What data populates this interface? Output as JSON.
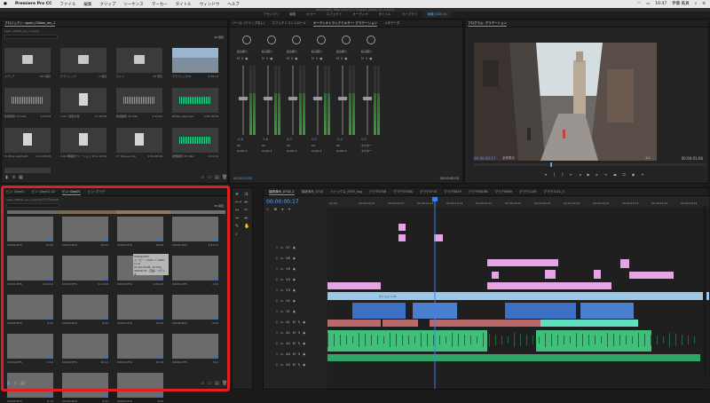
{
  "menubar": {
    "app_name": "Premiere Pro CC",
    "items": [
      "ファイル",
      "編集",
      "クリップ",
      "シーケンス",
      "マーカー",
      "タイトル",
      "ウィンドウ",
      "ヘルプ"
    ],
    "time": "16:47",
    "user": "伊藤 皓真"
  },
  "titlebar": {
    "text": "/Volumes/ito_Hikaru/Pro/ファイル/spain_03kbw_rev_1.prproj"
  },
  "workspaces": {
    "items": [
      "アセンブリ",
      "編集",
      "カラー",
      "エフェクト",
      "オーディオ",
      "タイトル",
      "ライブラリ",
      "編集 (CS5.5)"
    ],
    "active_index": 7
  },
  "project_panel": {
    "tab": "プロジェクト: spain_03kbw_rev_1",
    "project_file": "spain_03kbw_rev_1.prproj",
    "item_count": "46 項目",
    "items": [
      {
        "name": "メディア",
        "info": "101 項目",
        "kind": "folder"
      },
      {
        "name": "グラフィック",
        "info": "3 項目",
        "kind": "folder"
      },
      {
        "name": "ビルド",
        "info": "15 項目",
        "kind": "folder"
      },
      {
        "name": "グラフィック01",
        "info": "2:39:13",
        "kind": "image"
      },
      {
        "name": "新規録音 33.m4a",
        "info": "3:04:04",
        "kind": "audio"
      },
      {
        "name": "ri-01 \"見知の海\"",
        "info": "17:18:08",
        "kind": "doc"
      },
      {
        "name": "新規録音 35.m4a",
        "info": "3:14:00",
        "kind": "audio"
      },
      {
        "name": "Bilbao_Q&A.wav",
        "info": "5:05:18:09",
        "kind": "audio"
      },
      {
        "name": "ih Wine ballot.pdf",
        "info": "2:11:10:08",
        "kind": "doc"
      },
      {
        "name": "ti-02 再撮影ナレーション",
        "info": "2:51:10:04",
        "kind": "doc"
      },
      {
        "name": "17 Tenjus.m4a",
        "info": "2:19:28:06",
        "kind": "doc"
      },
      {
        "name": "新規録音 47.m4a",
        "info": "1:01:10",
        "kind": "audio"
      }
    ]
  },
  "mixer_panel": {
    "tabs": [
      "ソース: (クリップなし)",
      "エフェクトコントロール",
      "オーディオトラックミキサー: グラデーション",
      "メタデータ"
    ],
    "active_tab": 2,
    "channels": [
      "Audio 1",
      "Audio 2",
      "Audio 3",
      "Audio 4",
      "Audio 5",
      "マスター"
    ],
    "channel_ids": [
      "A1",
      "A2",
      "A3",
      "A4",
      "A5",
      "マスター"
    ],
    "mode_label": "読み取り",
    "values": [
      "-4.6",
      "-1.8",
      "0.0",
      "0.0",
      "-5.4",
      "0.0"
    ],
    "timecode_left": "00:00:00:00",
    "timecode_right": "00:00:00:00"
  },
  "program_panel": {
    "tab": "プログラム: グラデーション",
    "timecode": "00:00:00:17",
    "fit": "全体表示",
    "ratio": "1/2",
    "duration": "00:00:01:06"
  },
  "bin_panel": {
    "tabs": [
      "ビン: Day01",
      "ビン: Day01-02",
      "ビン: Day01",
      "ビン: グラデ"
    ],
    "active_tab": 2,
    "path": "spain_03kbw_rev_1.prproj\\グラデ\\Day01",
    "item_count": "38 項目",
    "clips": [
      {
        "name": "00022.MTS",
        "dur": "10:06"
      },
      {
        "name": "00023.MTS",
        "dur": "16:09"
      },
      {
        "name": "00024.MTS",
        "dur": "10:06"
      },
      {
        "name": "00025.MTS",
        "dur": "4:03:12"
      },
      {
        "name": "00031.MTS",
        "dur": "4:04:12"
      },
      {
        "name": "00032.MTS",
        "dur": "1:24:00"
      },
      {
        "name": "00033.MTS",
        "dur": "4:09:08"
      },
      {
        "name": "00034.MTS",
        "dur": "2:04"
      },
      {
        "name": "00035.MTS",
        "dur": "9:05"
      },
      {
        "name": "00036.MTS",
        "dur": "8:05"
      },
      {
        "name": "00037.MTS",
        "dur": "10:00"
      },
      {
        "name": "00038.MTS",
        "dur": "5:00"
      },
      {
        "name": "00039.MTS",
        "dur": "2:12"
      },
      {
        "name": "00040.MTS",
        "dur": "16:11"
      },
      {
        "name": "00041.MTS",
        "dur": "14:18"
      },
      {
        "name": "00042.MTS",
        "dur": "7:01"
      },
      {
        "name": "00043.MTS",
        "dur": "6:14"
      },
      {
        "name": "00044.MTS",
        "dur": "5:04"
      },
      {
        "name": "00045.MTS",
        "dur": "4:09"
      }
    ],
    "tooltip": {
      "title": "00049.MTS",
      "line1": "ムービー, 1920 × 1080 (1.0)",
      "line2": "00:00:15:08, 29.97p",
      "line3": "48000 Hz - 圧縮 - ステレオ"
    }
  },
  "timeline_panel": {
    "tabs": [
      "接続済み_0710_2",
      "接続済み_0710",
      "リミックス_0707_fog",
      "グラデ0708",
      "グラデ0708A",
      "グラデ0710",
      "グラデ0819",
      "グラデ0819B",
      "グラデ0809",
      "グラデ1109",
      "グラデ1121_3"
    ],
    "active_tab": 0,
    "timecode": "00:00:00:17",
    "ruler": [
      "00:00",
      "00:00:04:23",
      "00:00:09:23",
      "00:00:14:23",
      "00:00:19:23",
      "00:00:24:23",
      "00:00:29:23",
      "00:00:34:23",
      "00:00:39:23",
      "00:00:44:23",
      "00:00:49:23",
      "00:00:54:23",
      "00:00:59:23"
    ],
    "video_tracks": [
      "V7",
      "V6",
      "V5",
      "V4",
      "V3",
      "V2",
      "V1"
    ],
    "audio_tracks": [
      "A1",
      "A2",
      "A3",
      "A4",
      "A5"
    ],
    "track_title_clip": "タイトル 1.2ll",
    "audio_name": "Audio 1"
  },
  "colors": {
    "highlight": "#e02020",
    "accent": "#5ea0f0",
    "playhead": "#3a7ff0"
  }
}
